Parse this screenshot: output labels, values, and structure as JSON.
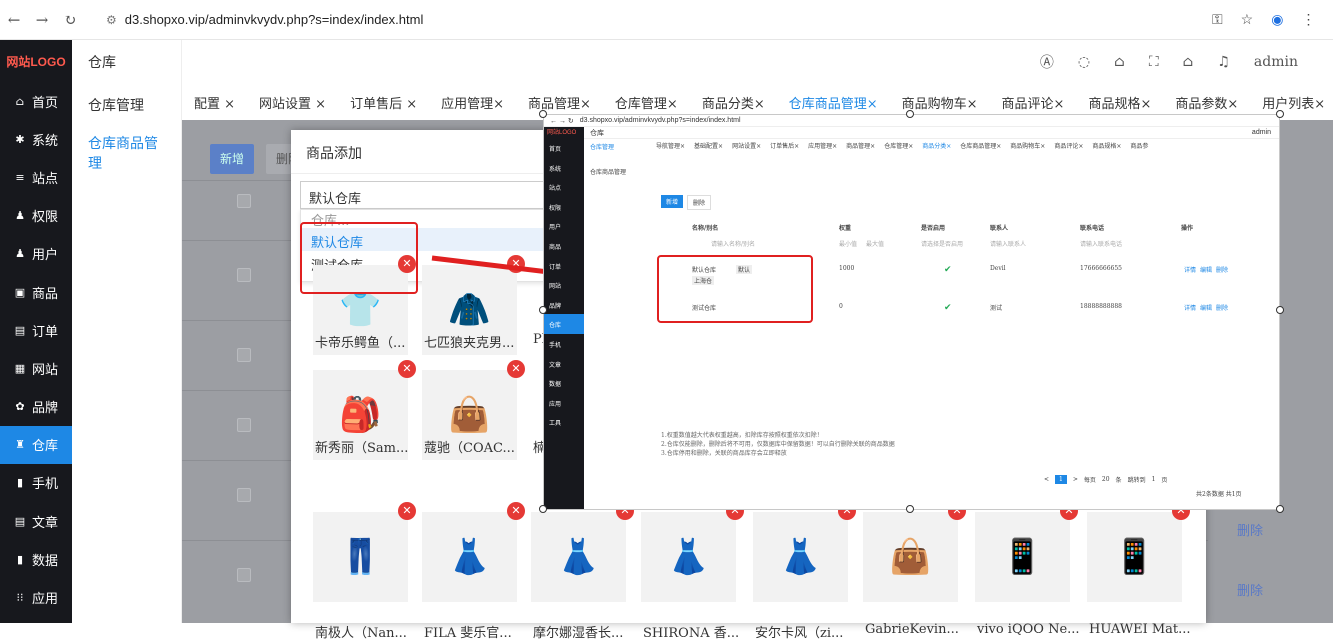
{
  "browser": {
    "url": "d3.shopxo.vip/adminvkvydv.php?s=index/index.html"
  },
  "logo": "网站LOGO",
  "sidebar": [
    {
      "label": "首页",
      "icon": "home-icon",
      "glyph": "⌂"
    },
    {
      "label": "系统",
      "icon": "gear-icon",
      "glyph": "✱"
    },
    {
      "label": "站点",
      "icon": "sliders-icon",
      "glyph": "≡"
    },
    {
      "label": "权限",
      "icon": "user-lock-icon",
      "glyph": "♟"
    },
    {
      "label": "用户",
      "icon": "user-icon",
      "glyph": "♟"
    },
    {
      "label": "商品",
      "icon": "box-icon",
      "glyph": "▣"
    },
    {
      "label": "订单",
      "icon": "order-icon",
      "glyph": "▤"
    },
    {
      "label": "网站",
      "icon": "site-icon",
      "glyph": "▦"
    },
    {
      "label": "品牌",
      "icon": "brand-icon",
      "glyph": "✿"
    },
    {
      "label": "仓库",
      "icon": "warehouse-icon",
      "glyph": "♜",
      "active": true
    },
    {
      "label": "手机",
      "icon": "phone-icon",
      "glyph": "▮"
    },
    {
      "label": "文章",
      "icon": "article-icon",
      "glyph": "▤"
    },
    {
      "label": "数据",
      "icon": "chart-icon",
      "glyph": "▮"
    },
    {
      "label": "应用",
      "icon": "apps-icon",
      "glyph": "⁝⁝"
    }
  ],
  "sub": {
    "title": "仓库",
    "items": [
      "仓库管理",
      "仓库商品管理"
    ]
  },
  "topbar": {
    "user": "admin"
  },
  "tabs": [
    "配置 ×",
    "网站设置 ×",
    "订单售后 ×",
    "应用管理×",
    "商品管理×",
    "仓库管理×",
    "商品分类×",
    "仓库商品管理×",
    "商品购物车×",
    "商品评论×",
    "商品规格×",
    "商品参数×",
    "用户列表×"
  ],
  "main": {
    "add": "新增",
    "delete": "删除",
    "row_delete": "删除"
  },
  "modal": {
    "title": "商品添加",
    "select_value": "默认仓库",
    "options": [
      "仓库...",
      "默认仓库",
      "测试仓库"
    ],
    "products": [
      {
        "name": "卡帝乐鳄鱼（..."
      },
      {
        "name": "七匹狼夹克男..."
      },
      {
        "name": "Pl"
      },
      {
        "name": "新秀丽（Sam..."
      },
      {
        "name": "蔻驰（COAC..."
      },
      {
        "name": "楠"
      },
      {
        "name": "南极人（Nan..."
      },
      {
        "name": "FILA 斐乐官..."
      },
      {
        "name": "摩尔娜湿香长..."
      },
      {
        "name": "SHIRONA 香..."
      },
      {
        "name": "安尔卡风（zi..."
      },
      {
        "name": "GabrieKevin..."
      },
      {
        "name": "vivo iQOO Ne..."
      },
      {
        "name": "HUAWEI Mat..."
      }
    ]
  },
  "inset": {
    "url": "d3.shopxo.vip/adminvkvydv.php?s=index/index.html",
    "title": "仓库",
    "admin": "admin",
    "sub": [
      "仓库管理",
      "仓库商品管理"
    ],
    "tabs": [
      "导航管理×",
      "基础配置×",
      "网站设置×",
      "订单售后×",
      "应用管理×",
      "商品管理×",
      "仓库管理×",
      "商品分类×",
      "仓库商品管理×",
      "商品购物车×",
      "商品评论×",
      "商品规格×",
      "商品参"
    ],
    "add": "新增",
    "del": "删除",
    "cols": [
      "名称/别名",
      "权重",
      "是否启用",
      "联系人",
      "联系电话",
      "操作"
    ],
    "placeholders": [
      "请输入名称/别名",
      "最小值",
      "最大值",
      "请选择是否启用",
      "请输入联系人",
      "请输入联系电话"
    ],
    "rows": [
      {
        "name": "默认仓库",
        "tag": "默认",
        "alias": "上海仓",
        "weight": "1000",
        "contact": "Devil",
        "phone": "17666666655"
      },
      {
        "name": "测试仓库",
        "weight": "0",
        "contact": "测试",
        "phone": "18888888888"
      }
    ],
    "ops": [
      "详情",
      "编辑",
      "删除"
    ],
    "notes": [
      "1.权重数值越大代表权重越高，扣除库存按照权重依次扣除！",
      "2.仓库仅能删除，删除后将不可用，仅数据库中保留数据！可以自行删除关联的商品数据",
      "3.仓库停用和删除，关联的商品库存会立即释放"
    ],
    "pager": {
      "current": "1",
      "per_page_label": "每页",
      "per_page": "20",
      "unit": "条",
      "jump_label": "跳转到",
      "jump": "1",
      "page": "页",
      "total": "共2条数据 共1页"
    },
    "sidebar": [
      "首页",
      "系统",
      "站点",
      "权限",
      "用户",
      "商品",
      "订单",
      "网站",
      "品牌",
      "仓库",
      "手机",
      "文章",
      "数据",
      "应用",
      "工具"
    ]
  }
}
